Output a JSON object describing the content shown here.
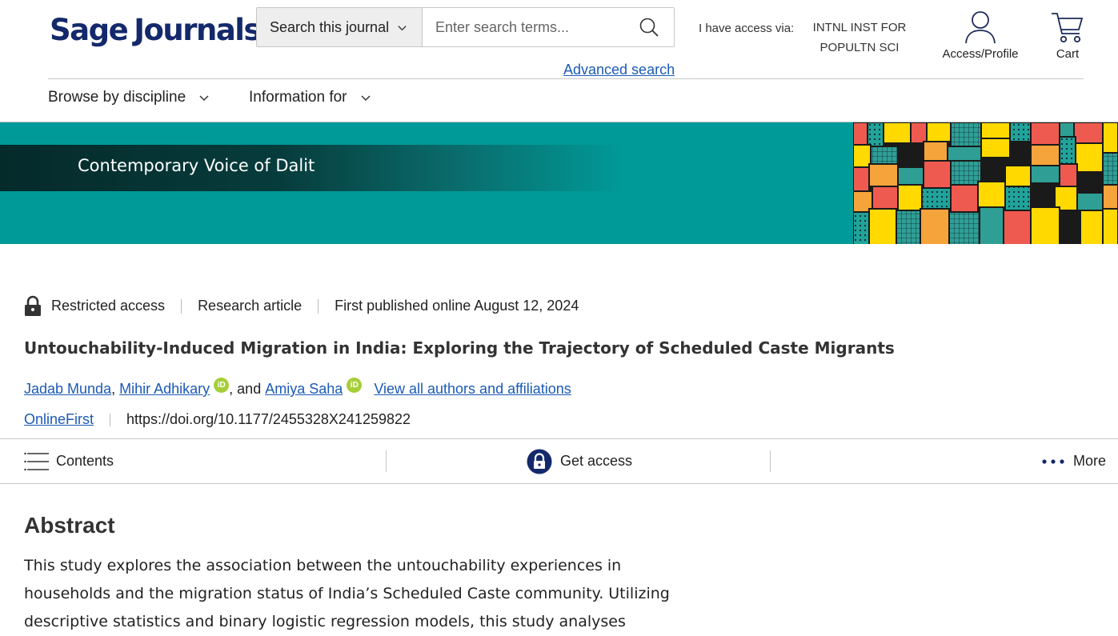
{
  "header": {
    "logo_part1": "Sage",
    "logo_part2": "Journals",
    "search_scope": "Search this journal",
    "search_placeholder": "Enter search terms...",
    "advanced_search": "Advanced search",
    "access_label": "I have access via:",
    "access_institution_line1": "INTNL INST FOR",
    "access_institution_line2": "POPULTN SCI",
    "access_profile": "Access/Profile",
    "cart": "Cart",
    "brand_color": "#14296b",
    "link_color": "#1c5ab6"
  },
  "nav": {
    "browse": "Browse by discipline",
    "info": "Information for"
  },
  "banner": {
    "journal_title": "Contemporary Voice of Dalit",
    "bg_color": "#009a98"
  },
  "article": {
    "access": "Restricted access",
    "type": "Research article",
    "published": "First published online August 12, 2024",
    "title": "Untouchability-Induced Migration in India: Exploring the Trajectory of Scheduled Caste Migrants",
    "authors": {
      "a1": "Jadab Munda",
      "comma1": ",",
      "a2": "Mihir Adhikary",
      "and": ", and",
      "a3": "Amiya Saha",
      "view_all": "View all authors and affiliations",
      "orcid_label": "iD"
    },
    "status": "OnlineFirst",
    "doi": "https://doi.org/10.1177/2455328X241259822"
  },
  "action_bar": {
    "contents": "Contents",
    "get_access": "Get access",
    "more": "More"
  },
  "abstract": {
    "heading": "Abstract",
    "text": "This study explores the association between the untouchability experiences in households and the migration status of India’s Scheduled Caste community. Utilizing descriptive statistics and binary logistic regression models, this study analyses migration"
  }
}
